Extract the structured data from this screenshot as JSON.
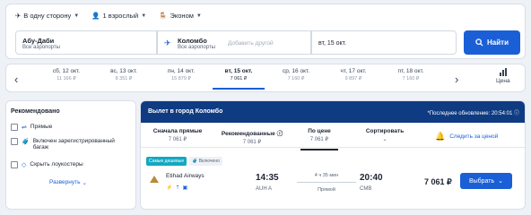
{
  "search": {
    "trip_type": "В одну сторону",
    "passengers": "1 взрослый",
    "cabin": "Эконом",
    "from_city": "Абу-Даби",
    "from_sub": "Все аэропорты",
    "to_city": "Коломбо",
    "to_sub": "Все аэропорты",
    "add_other": "Добавить другой",
    "date": "вт, 15 окт.",
    "find_label": "Найти"
  },
  "dates": [
    {
      "day": "сб, 12 окт.",
      "price": "11 166 ₽"
    },
    {
      "day": "вс, 13 окт.",
      "price": "8 351 ₽"
    },
    {
      "day": "пн, 14 окт.",
      "price": "15 879 ₽"
    },
    {
      "day": "вт, 15 окт.",
      "price": "7 061 ₽"
    },
    {
      "day": "ср, 16 окт.",
      "price": "7 160 ₽"
    },
    {
      "day": "чт, 17 окт.",
      "price": "9 897 ₽"
    },
    {
      "day": "пт, 18 окт.",
      "price": "7 160 ₽"
    }
  ],
  "price_chart_label": "Цена",
  "filters": {
    "title": "Рекомендовано",
    "direct": "Прямые",
    "baggage": "Включен зарегистрированный багаж",
    "hide_lowcost": "Скрыть лоукостеры",
    "expand": "Развернуть"
  },
  "results": {
    "title": "Вылет в город Коломбо",
    "last_update": "*Последнее обновление: 20:54:01",
    "sort": [
      {
        "label": "Сначала прямые",
        "value": "7 061 ₽"
      },
      {
        "label": "Рекомендованные",
        "value": "7 061 ₽"
      },
      {
        "label": "По цене",
        "value": "7 061 ₽"
      },
      {
        "label": "Сортировать",
        "value": ""
      }
    ],
    "track_price": "Следить за ценой",
    "tag_cheapest": "Самые дешевые",
    "tag_included": "Включено",
    "airline": "Etihad Airways",
    "dep_time": "14:35",
    "dep_airport": "AUH A",
    "duration": "4 ч 35 мин",
    "stops": "Прямой",
    "arr_time": "20:40",
    "arr_airport": "CMB",
    "price": "7 061 ₽",
    "select_label": "Выбрать"
  }
}
